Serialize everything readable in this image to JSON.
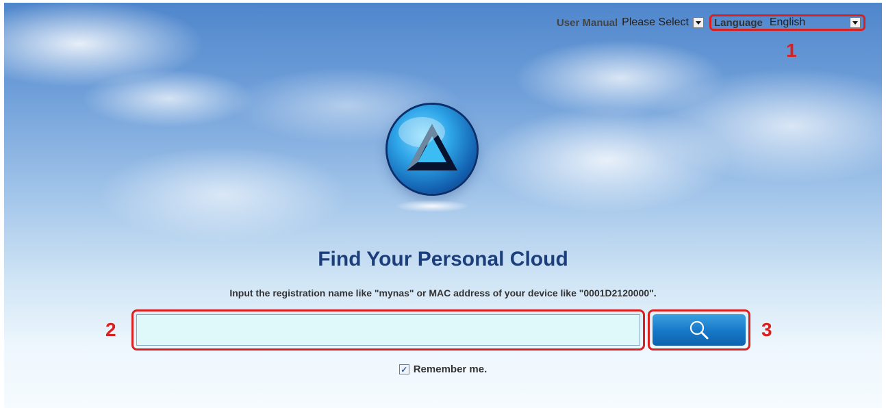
{
  "topbar": {
    "user_manual": "User Manual",
    "manual_select": "Please Select",
    "language_label": "Language",
    "language_value": "English"
  },
  "callouts": {
    "one": "1",
    "two": "2",
    "three": "3"
  },
  "main": {
    "title": "Find Your Personal Cloud",
    "hint": "Input the registration name like \"mynas\" or MAC address of your device like \"0001D2120000\".",
    "search_value": "",
    "remember_label": "Remember me.",
    "remember_checked": true
  },
  "icons": {
    "dropdown": "chevron-down-icon",
    "search": "magnifier-icon",
    "logo": "app-logo"
  },
  "colors": {
    "callout": "#d92020",
    "title": "#1c3f7c",
    "button": "#1677c7",
    "input_bg": "#dff9fb"
  }
}
